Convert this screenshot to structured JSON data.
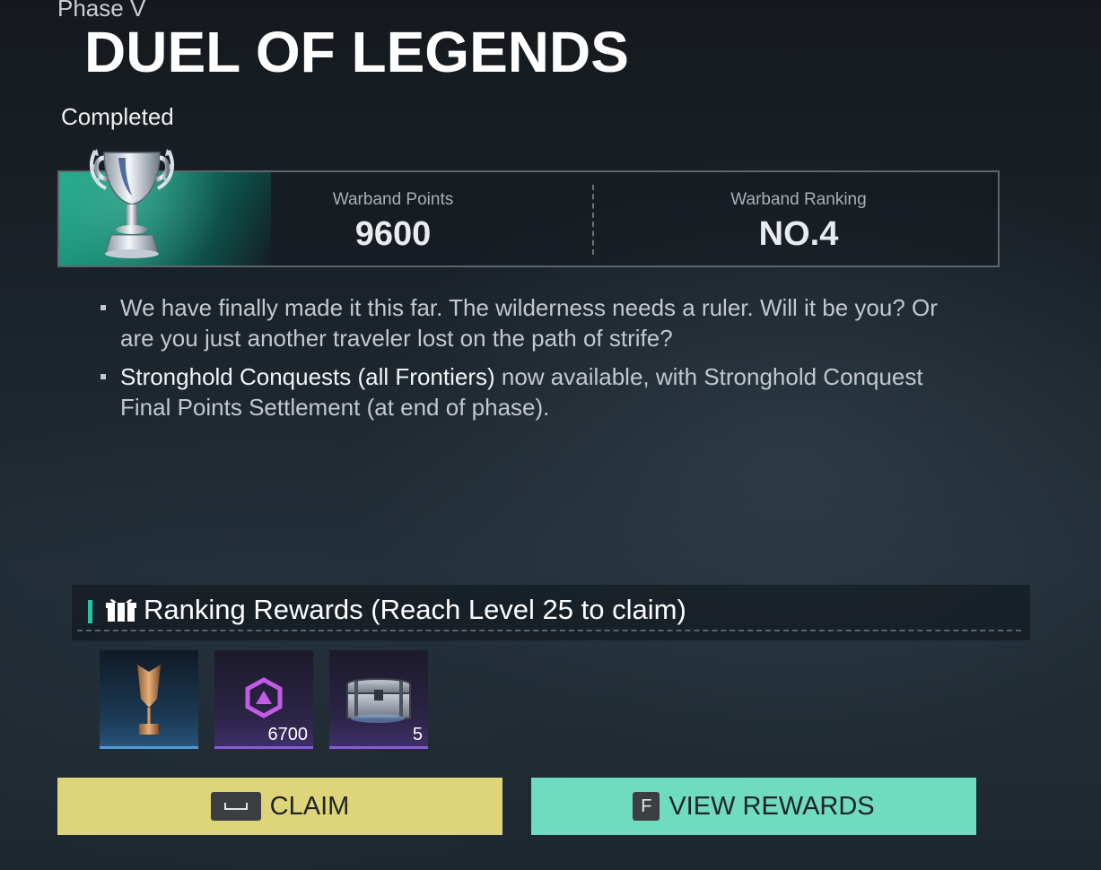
{
  "header": {
    "phase": "Phase V",
    "title": "DUEL OF LEGENDS",
    "status": "Completed"
  },
  "stats": {
    "points_label": "Warband Points",
    "points_value": "9600",
    "ranking_label": "Warband Ranking",
    "ranking_value": "NO.4"
  },
  "description": {
    "bullet1": "We have finally made it this far. The wilderness needs a ruler. Will it be you? Or are you just another traveler lost on the path of strife?",
    "bullet2_highlight": "Stronghold Conquests (all Frontiers)",
    "bullet2_rest": " now available, with Stronghold Conquest Final Points Settlement (at end of phase)."
  },
  "rewards": {
    "title": "Ranking Rewards (Reach Level 25 to claim)",
    "items": [
      {
        "icon": "bronze-trophy-icon",
        "qty": ""
      },
      {
        "icon": "currency-emblem-icon",
        "qty": "6700"
      },
      {
        "icon": "silver-chest-icon",
        "qty": "5"
      }
    ]
  },
  "buttons": {
    "claim_key": "",
    "claim_label": "CLAIM",
    "view_key": "F",
    "view_label": "VIEW REWARDS"
  },
  "colors": {
    "accent_teal": "#27c2a3",
    "claim_yellow": "#ded57a",
    "view_teal": "#6fdcc0",
    "epic_purple": "#8a5bd6",
    "rare_blue": "#4f9ad6"
  }
}
